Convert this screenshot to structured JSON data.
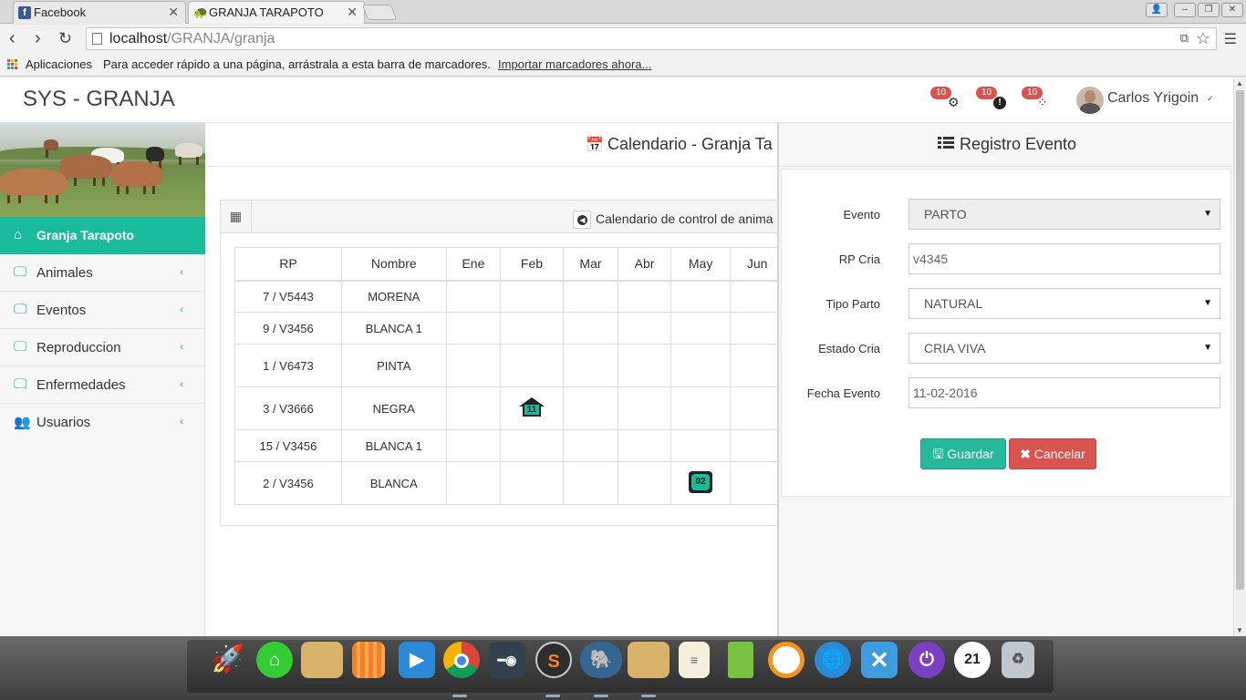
{
  "browser": {
    "tabs": [
      {
        "title": "Facebook",
        "icon": "facebook-icon",
        "active": false
      },
      {
        "title": "GRANJA TARAPOTO",
        "icon": "turtle-icon",
        "active": true
      }
    ],
    "url_host": "localhost",
    "url_path": "/GRANJA/granja",
    "bookmarks": {
      "apps_label": "Aplicaciones",
      "hint": "Para acceder rápido a una página, arrástrala a esta barra de marcadores.",
      "import_link": "Importar marcadores ahora..."
    }
  },
  "header": {
    "brand": "SYS - GRANJA",
    "notifications": [
      {
        "count": "10",
        "icon": "gear-icon"
      },
      {
        "count": "10",
        "icon": "alert-icon"
      },
      {
        "count": "10",
        "icon": "spinner-icon"
      }
    ],
    "user_name": "Carlos Yrigoin"
  },
  "sidebar": {
    "items": [
      {
        "label": "Granja Tarapoto",
        "icon": "home-icon",
        "active": true
      },
      {
        "label": "Animales",
        "icon": "monitor-icon"
      },
      {
        "label": "Eventos",
        "icon": "monitor-icon"
      },
      {
        "label": "Reproduccion",
        "icon": "monitor-icon"
      },
      {
        "label": "Enfermedades",
        "icon": "monitor-icon"
      },
      {
        "label": "Usuarios",
        "icon": "users-icon"
      }
    ]
  },
  "main": {
    "title": "Calendario - Granja Ta",
    "calendar_heading": "Calendario de control de anima",
    "columns": [
      "RP",
      "Nombre",
      "Ene",
      "Feb",
      "Mar",
      "Abr",
      "May",
      "Jun"
    ],
    "rows": [
      {
        "rp": "7 / V5443",
        "nombre": "MORENA"
      },
      {
        "rp": "9 / V3456",
        "nombre": "BLANCA 1"
      },
      {
        "rp": "1 / V6473",
        "nombre": "PINTA"
      },
      {
        "rp": "3 / V3666",
        "nombre": "NEGRA",
        "event": {
          "month": "Feb",
          "day": "11",
          "icon": "home-event-icon"
        }
      },
      {
        "rp": "15 / V3456",
        "nombre": "BLANCA 1"
      },
      {
        "rp": "2 / V3456",
        "nombre": "BLANCA",
        "event": {
          "month": "May",
          "day": "02",
          "icon": "event-badge-icon"
        }
      }
    ]
  },
  "panel": {
    "title": "Registro Evento",
    "fields": {
      "evento": {
        "label": "Evento",
        "value": "PARTO"
      },
      "rp_cria": {
        "label": "RP Cria",
        "value": "v4345"
      },
      "tipo_parto": {
        "label": "Tipo Parto",
        "value": "NATURAL"
      },
      "estado_cria": {
        "label": "Estado Cria",
        "value": "CRIA VIVA"
      },
      "fecha_evento": {
        "label": "Fecha Evento",
        "value": "11-02-2016"
      }
    },
    "save_label": "Guardar",
    "cancel_label": "Cancelar"
  },
  "dock": {
    "apps": [
      "rocket-icon",
      "green-app-icon",
      "folder-icon",
      "bag-icon",
      "video-icon",
      "chrome-icon",
      "toggle-icon",
      "s-app-icon",
      "postgres-icon",
      "folder-icon",
      "notes-icon",
      "battery-icon",
      "ring-icon",
      "globe-icon",
      "x-app-icon",
      "power-icon",
      "clock-icon",
      "trash-icon"
    ],
    "clock_text": "21"
  },
  "colors": {
    "accent": "#1abb9c",
    "danger": "#d9534f",
    "save": "#26b99a"
  }
}
